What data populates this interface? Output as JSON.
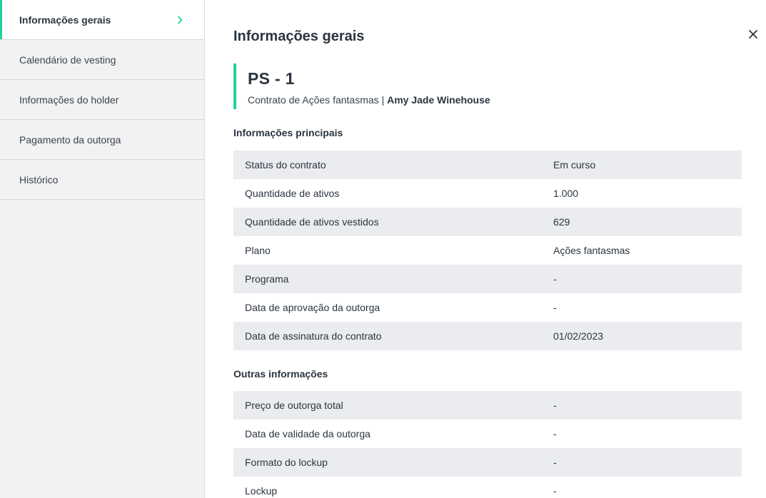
{
  "sidebar": {
    "items": [
      {
        "label": "Informações gerais",
        "active": true
      },
      {
        "label": "Calendário de vesting"
      },
      {
        "label": "Informações do holder"
      },
      {
        "label": "Pagamento da outorga"
      },
      {
        "label": "Histórico"
      }
    ]
  },
  "main": {
    "title": "Informações gerais",
    "contract": {
      "id": "PS - 1",
      "type": "Contrato de Ações fantasmas",
      "separator": "|",
      "holder": "Amy Jade Winehouse"
    },
    "sections": [
      {
        "title": "Informações principais",
        "rows": [
          {
            "label": "Status do contrato",
            "value": "Em curso"
          },
          {
            "label": "Quantidade de ativos",
            "value": "1.000"
          },
          {
            "label": "Quantidade de ativos vestidos",
            "value": "629"
          },
          {
            "label": "Plano",
            "value": "Ações fantasmas"
          },
          {
            "label": "Programa",
            "value": "-"
          },
          {
            "label": "Data de aprovação da outorga",
            "value": "-"
          },
          {
            "label": "Data de assinatura do contrato",
            "value": "01/02/2023"
          }
        ]
      },
      {
        "title": "Outras informações",
        "rows": [
          {
            "label": "Preço de outorga total",
            "value": "-"
          },
          {
            "label": "Data de validade da outorga",
            "value": "-"
          },
          {
            "label": "Formato do lockup",
            "value": "-"
          },
          {
            "label": "Lockup",
            "value": "-"
          }
        ]
      }
    ]
  },
  "icons": {
    "chevron": "chevron-right-icon",
    "close": "close-icon"
  },
  "colors": {
    "accent": "#1fd0a0",
    "text": "#2b3440",
    "row_stripe": "#ebecef",
    "sidebar_bg": "#f2f2f2"
  }
}
